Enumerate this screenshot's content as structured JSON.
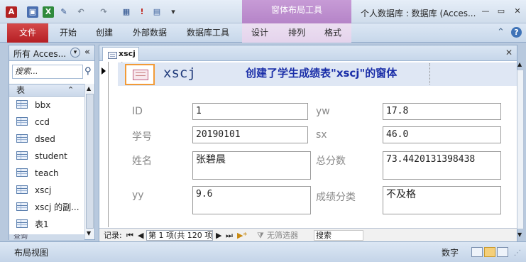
{
  "titlebar": {
    "context_tab": "窗体布局工具",
    "window_title": "个人数据库 : 数据库 (Acces...",
    "minimize": "—",
    "restore": "▭",
    "close": "✕"
  },
  "ribbon": {
    "file_tab": "文件",
    "tabs": [
      "开始",
      "创建",
      "外部数据",
      "数据库工具",
      "设计",
      "排列",
      "格式"
    ],
    "help": "?"
  },
  "nav": {
    "header": "所有 Acces...",
    "search_placeholder": "搜索...",
    "group": "表",
    "items": [
      "bbx",
      "ccd",
      "dsed",
      "student",
      "teach",
      "xscj",
      "xscj 的副...",
      "表1"
    ],
    "footer_group": "查询"
  },
  "document": {
    "tab_label": "xscj",
    "header_title": "xscj",
    "header_caption": "创建了学生成绩表\"xscj\"的窗体",
    "fields": {
      "id_label": "ID",
      "id_value": "1",
      "xuehao_label": "学号",
      "xuehao_value": "20190101",
      "xingming_label": "姓名",
      "xingming_value": "张碧晨",
      "yy_label": "yy",
      "yy_value": "9.6",
      "yw_label": "yw",
      "yw_value": "17.8",
      "sx_label": "sx",
      "sx_value": "46.0",
      "zongfen_label": "总分数",
      "zongfen_value": "73.4420131398438",
      "fenlei_label": "成绩分类",
      "fenlei_value": "不及格"
    }
  },
  "record_nav": {
    "label": "记录:",
    "current": "第 1 项(共 120 项",
    "filter": "无筛选器",
    "search": "搜索"
  },
  "statusbar": {
    "view": "布局视图",
    "mode": "数字"
  }
}
